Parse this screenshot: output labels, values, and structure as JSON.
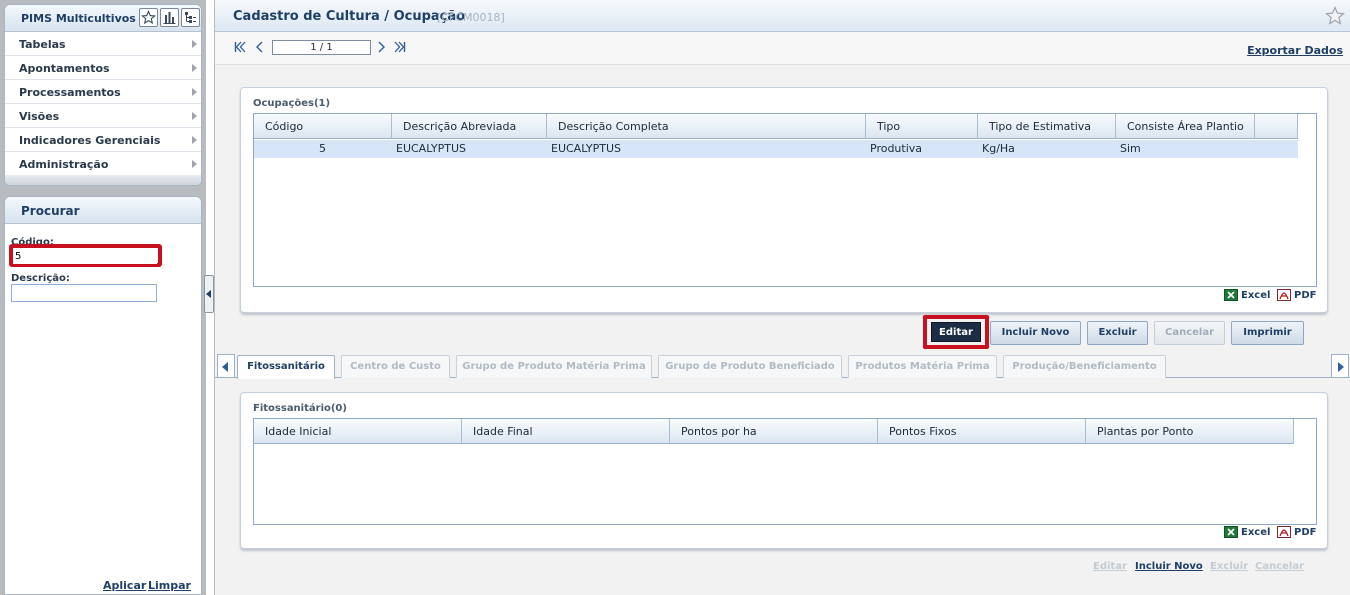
{
  "sidebar": {
    "app_title": "PIMS Multicultivos",
    "toolbar_icons": [
      "star-icon",
      "bar-chart-icon",
      "tree-list-icon"
    ],
    "menu": [
      {
        "label": "Tabelas"
      },
      {
        "label": "Apontamentos"
      },
      {
        "label": "Processamentos"
      },
      {
        "label": "Visões"
      },
      {
        "label": "Indicadores Gerenciais"
      },
      {
        "label": "Administração"
      }
    ]
  },
  "search": {
    "title": "Procurar",
    "codigo_label": "Código:",
    "codigo_value": "5",
    "descricao_label": "Descrição:",
    "descricao_value": "",
    "apply": "Aplicar",
    "clear": "Limpar"
  },
  "header": {
    "title": "Cadastro de Cultura / Ocupação",
    "code": "[CFCM0018]"
  },
  "pager": {
    "page": "1 / 1",
    "export": "Exportar Dados"
  },
  "ocupacoes": {
    "title": "Ocupações(1)",
    "columns": [
      "Código",
      "Descrição Abreviada",
      "Descrição Completa",
      "Tipo",
      "Tipo de Estimativa",
      "Consiste Área Plantio"
    ],
    "rows": [
      [
        "5",
        "EUCALYPTUS",
        "EUCALYPTUS",
        "Produtiva",
        "Kg/Ha",
        "Sim"
      ]
    ],
    "export_excel": "Excel",
    "export_pdf": "PDF"
  },
  "actions": {
    "edit": "Editar",
    "new": "Incluir Novo",
    "delete": "Excluir",
    "cancel": "Cancelar",
    "print": "Imprimir"
  },
  "tabs": [
    {
      "label": "Fitossanitário",
      "active": true
    },
    {
      "label": "Centro de Custo",
      "active": false
    },
    {
      "label": "Grupo de Produto Matéria Prima",
      "active": false
    },
    {
      "label": "Grupo de Produto Beneficiado",
      "active": false
    },
    {
      "label": "Produtos Matéria Prima",
      "active": false
    },
    {
      "label": "Produção/Beneficiamento",
      "active": false
    }
  ],
  "fitossanitario": {
    "title": "Fitossanitário(0)",
    "columns": [
      "Idade Inicial",
      "Idade Final",
      "Pontos por ha",
      "Pontos Fixos",
      "Plantas por Ponto"
    ],
    "export_excel": "Excel",
    "export_pdf": "PDF"
  },
  "sub_actions": {
    "edit": "Editar",
    "new": "Incluir Novo",
    "delete": "Excluir",
    "cancel": "Cancelar"
  },
  "colors": {
    "accent": "#1f3f66",
    "highlight": "#c8101e",
    "selected_row": "#d6e6f8"
  }
}
